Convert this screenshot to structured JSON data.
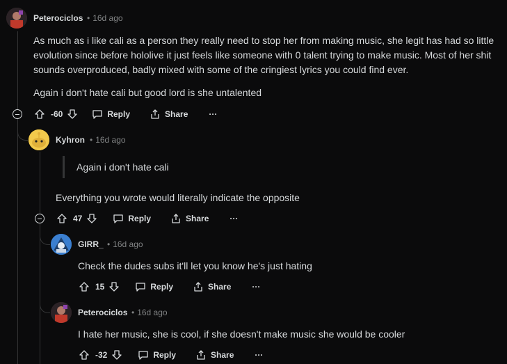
{
  "comments": [
    {
      "author": "Peterociclos",
      "time": "16d ago",
      "paragraphs": [
        "As much as i like cali as a person they really need to stop her from making music, she legit has had so little evolution since before hololive it just feels like someone with 0 talent trying to make music. Most of her shit sounds overproduced, badly mixed with some of the cringiest lyrics you could find ever.",
        "Again i don't hate cali but good lord is she untalented"
      ],
      "score": "-60"
    },
    {
      "author": "Kyhron",
      "time": "16d ago",
      "quote": "Again i don't hate cali",
      "paragraphs": [
        "Everything you wrote would literally indicate the opposite"
      ],
      "score": "47"
    },
    {
      "author": "GIRR_",
      "time": "16d ago",
      "paragraphs": [
        "Check the dudes subs it'll let you know he's just hating"
      ],
      "score": "15"
    },
    {
      "author": "Peterociclos",
      "time": "16d ago",
      "paragraphs": [
        "I hate her music, she is cool, if she doesn't make music she would be cooler"
      ],
      "score": "-32"
    }
  ],
  "actions": {
    "reply": "Reply",
    "share": "Share",
    "more": "···"
  },
  "dot": "•",
  "icons": {
    "upvote": "arrow-up-icon",
    "downvote": "arrow-down-icon",
    "reply": "chat-bubble-icon",
    "share": "share-icon",
    "more": "ellipsis-icon",
    "collapse": "collapse-minus-icon"
  }
}
